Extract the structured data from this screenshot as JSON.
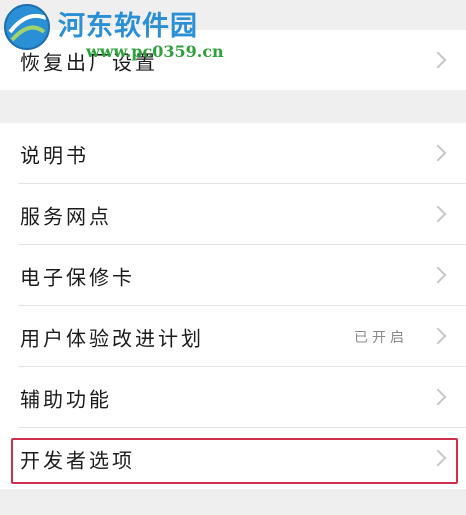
{
  "watermark": {
    "title": "河东软件园",
    "url": "www.pc0359.cn"
  },
  "top_group": {
    "items": [
      {
        "label": "恢复出厂设置",
        "value": ""
      }
    ]
  },
  "main_group": {
    "items": [
      {
        "label": "说明书",
        "value": ""
      },
      {
        "label": "服务网点",
        "value": ""
      },
      {
        "label": "电子保修卡",
        "value": ""
      },
      {
        "label": "用户体验改进计划",
        "value": "已开启"
      },
      {
        "label": "辅助功能",
        "value": ""
      },
      {
        "label": "开发者选项",
        "value": ""
      }
    ]
  },
  "colors": {
    "highlight_border": "#d0314a",
    "watermark_blue": "#2b8fd6",
    "watermark_green": "#2ea13a"
  }
}
